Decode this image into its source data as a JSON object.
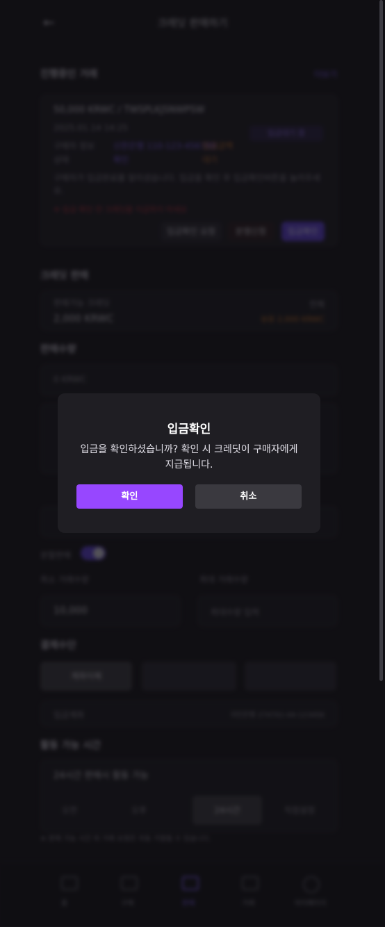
{
  "header": {
    "title": "크레딧 판매하기",
    "back_icon": "arrow-left-icon"
  },
  "ongoing": {
    "section_title": "진행중인 거래",
    "more_link": "더보기",
    "trade_title": "50,000 KRWC / TWSPLKJSNWPSW",
    "sub": "2025.01.14 14:25",
    "status_badge": "입금대기 중",
    "row1_label": "구매자 정보",
    "row1_value": "신한은행 110-123-456789",
    "row1_extra": "입금금액",
    "row2_label": "상태",
    "row2_value": "확인",
    "row2_extra": "대기",
    "notice": "구매자가 입금완료를 알리셨습니다. 입금을 확인 후 입금확인버튼을 눌러주세요.",
    "warning": "※ 입금 확인 전 크레딧을 지급하지 마세요",
    "btn_check": "입금확인 요청",
    "btn_dispute": "분쟁신청",
    "btn_confirm": "입금확인"
  },
  "credit": {
    "section_title": "크레딧 판매",
    "field_label": "판매가능 크레딧",
    "field_value": "2,000 KRWC",
    "field_right_top": "전체",
    "field_right_bottom": "보유 2,000 KRWC"
  },
  "amount": {
    "section_title": "판매수량",
    "placeholder": "0 KRWC"
  },
  "partial": {
    "label": "분할판매"
  },
  "limits": {
    "min_label": "최소 거래수량",
    "min_value": "10,000",
    "max_label": "최대 거래수량",
    "max_placeholder": "최대수량 입력"
  },
  "payment": {
    "section_title": "결제수단",
    "methods": [
      "계좌이체",
      "",
      ""
    ],
    "account_label": "입금계좌",
    "account_value": "국민은행 274701-04-123456"
  },
  "hours": {
    "section_title": "활동 가능 시간",
    "value": "24시간 판매시 활동 가능",
    "options": [
      "오전",
      "오후",
      "24시간",
      "직접설정"
    ],
    "footnote": "※ 판매 가능 시간 외 거래 요청은 자동 거절될 수 있습니다."
  },
  "bottom_nav": [
    "홈",
    "구매",
    "판매",
    "거래",
    "마이페이지"
  ],
  "modal": {
    "title": "입금확인",
    "message_line1": "입금을 확인하셨습니까? 확인 시 크레딧이 구매자에게",
    "message_line2": "지급됩니다.",
    "confirm_label": "확인",
    "cancel_label": "취소"
  },
  "colors": {
    "accent": "#9747ff",
    "modal_bg": "#1f1e23",
    "cancel_bg": "#3a393f"
  }
}
